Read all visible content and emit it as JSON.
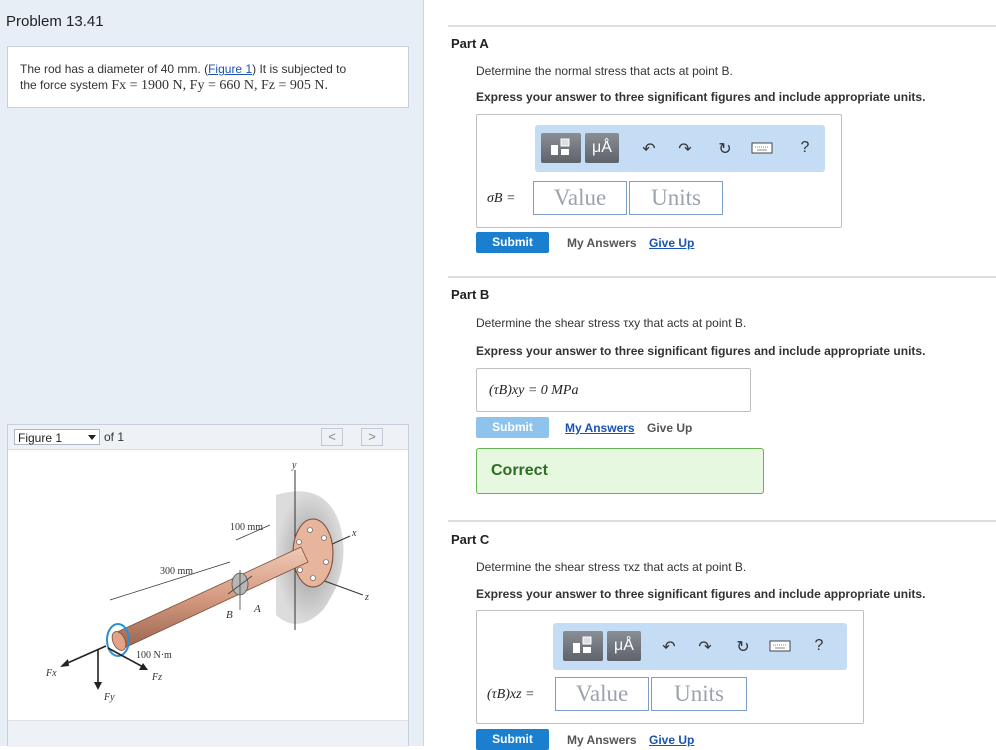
{
  "problem": {
    "title": "Problem 13.41",
    "text_before_link": "The rod has a diameter of 40 mm. (",
    "figure_link": "Figure 1",
    "text_after_link": ") It is subjected to",
    "line2_prefix": "the force system ",
    "forces_text": "Fx = 1900 N, Fy = 660 N, Fz = 905 N."
  },
  "figure_panel": {
    "selector_value": "Figure 1",
    "of_label": "of 1",
    "prev_symbol": "<",
    "next_symbol": ">",
    "labels": {
      "y": "y",
      "x": "x",
      "z": "z",
      "dim_100": "100 mm",
      "dim_300": "300 mm",
      "moment": "100 N·m",
      "A": "A",
      "B": "B",
      "Fx": "Fx",
      "Fy": "Fy",
      "Fz": "Fz"
    }
  },
  "toolbar_labels": {
    "templates_icon": "templates-icon",
    "units_button": "μÅ",
    "undo_icon": "undo-icon",
    "redo_icon": "redo-icon",
    "reset_icon": "reset-icon",
    "keyboard_icon": "keyboard-icon",
    "help": "?"
  },
  "part_a": {
    "title": "Part A",
    "question": "Determine the normal stress that acts at point B.",
    "instruction": "Express your answer to three significant figures and include appropriate units.",
    "label": "σB =",
    "value_placeholder": "Value",
    "units_placeholder": "Units",
    "submit": "Submit",
    "my_answers": "My Answers",
    "give_up": "Give Up"
  },
  "part_b": {
    "title": "Part B",
    "question": "Determine the shear stress τxy that acts at point B.",
    "instruction": "Express your answer to three significant figures and include appropriate units.",
    "answer": "(τB)xy = 0 MPa",
    "submit": "Submit",
    "my_answers": "My Answers",
    "give_up": "Give Up",
    "feedback": "Correct"
  },
  "part_c": {
    "title": "Part C",
    "question": "Determine the shear stress τxz that acts at point B.",
    "instruction": "Express your answer to three significant figures and include appropriate units.",
    "label": "(τB)xz =",
    "value_placeholder": "Value",
    "units_placeholder": "Units",
    "submit": "Submit",
    "my_answers": "My Answers",
    "give_up": "Give Up"
  },
  "colors": {
    "submit_blue": "#1b7fcf",
    "correct_green": "#2d6e24",
    "toolbar_blue": "#c5dcf5"
  }
}
